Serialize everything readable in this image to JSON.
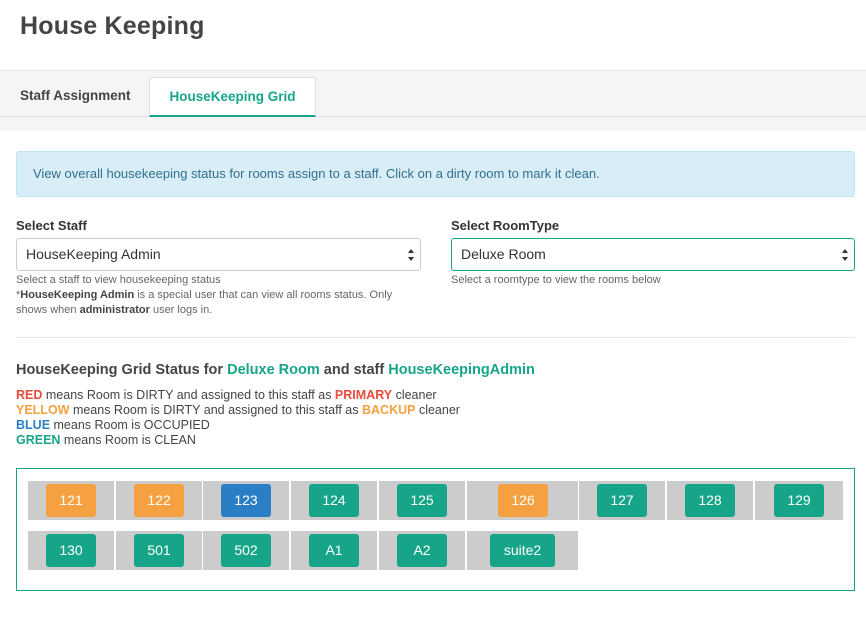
{
  "page": {
    "title": "House Keeping"
  },
  "tabs": {
    "staff_assignment": "Staff Assignment",
    "housekeeping_grid": "HouseKeeping Grid"
  },
  "alert": {
    "text": "View overall housekeeping status for rooms assign to a staff. Click on a dirty room to mark it clean."
  },
  "staff_select": {
    "label": "Select Staff",
    "value": "HouseKeeping Admin",
    "help_line1": "Select a staff to view housekeeping status",
    "help_prefix": "*",
    "help_bold1": "HouseKeeping Admin",
    "help_mid": " is a special user that can view all rooms status. Only",
    "help_line3_start": "shows when ",
    "help_bold2": "administrator",
    "help_end": " user logs in."
  },
  "roomtype_select": {
    "label": "Select RoomType",
    "value": "Deluxe Room",
    "help": "Select a roomtype to view the rooms below"
  },
  "status": {
    "prefix": "HouseKeeping Grid Status for ",
    "roomtype": "Deluxe Room",
    "middle": " and staff ",
    "staff": "HouseKeepingAdmin"
  },
  "legend": {
    "red_word": "RED",
    "red_text": " means Room is DIRTY and assigned to this staff as ",
    "primary_word": "PRIMARY",
    "red_end": " cleaner",
    "yellow_word": "YELLOW",
    "yellow_text": " means Room is DIRTY and assigned to this staff as ",
    "backup_word": "BACKUP",
    "yellow_end": " cleaner",
    "blue_word": "BLUE",
    "blue_text": " means Room is OCCUPIED",
    "green_word": "GREEN",
    "green_text": " means Room is CLEAN"
  },
  "colors": {
    "green": "#17a589",
    "orange": "#f5a142",
    "blue": "#2a7fc4",
    "red": "#e74c3c"
  },
  "rooms": [
    {
      "label": "121",
      "status": "orange"
    },
    {
      "label": "122",
      "status": "orange"
    },
    {
      "label": "123",
      "status": "blue"
    },
    {
      "label": "124",
      "status": "green"
    },
    {
      "label": "125",
      "status": "green"
    },
    {
      "label": "126",
      "status": "orange"
    },
    {
      "label": "127",
      "status": "green"
    },
    {
      "label": "128",
      "status": "green"
    },
    {
      "label": "129",
      "status": "green"
    },
    {
      "label": "130",
      "status": "green"
    },
    {
      "label": "501",
      "status": "green"
    },
    {
      "label": "502",
      "status": "green"
    },
    {
      "label": "A1",
      "status": "green"
    },
    {
      "label": "A2",
      "status": "green"
    },
    {
      "label": "suite2",
      "status": "green"
    }
  ]
}
